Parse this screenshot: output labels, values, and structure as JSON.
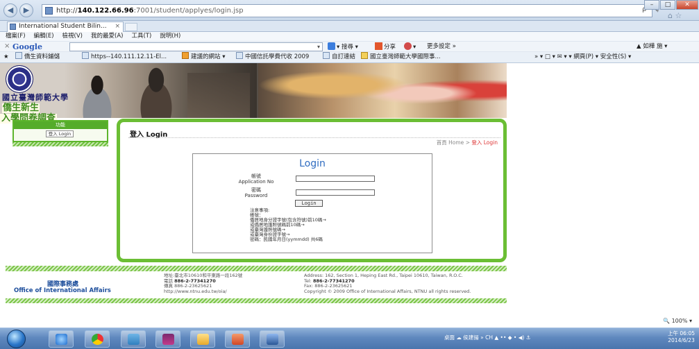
{
  "browser": {
    "address": {
      "prefix": "http://",
      "host": "140.122.66.96",
      "path": ":7001/student/applyes/login.jsp"
    },
    "address_icons": "ρ • ¢",
    "tab_title": "International Student Bilin...",
    "tab_close": "×",
    "menu": [
      "檔案(F)",
      "編輯(E)",
      "檢視(V)",
      "我的最愛(A)",
      "工具(T)",
      "說明(H)"
    ],
    "google": {
      "logo": "Google",
      "input_hint": "▾",
      "search_btn": "▾ 搜尋 ▾",
      "share_btn": "分享",
      "more_btn": "▾",
      "settings": "更多設定 »",
      "user": "如樺 施 ▾"
    },
    "favorites": [
      "僑生資料鋪儲",
      "https--140.111.12.11-El...",
      "建議的網站 ▾",
      "中國信託學費代收 2009",
      "自訂連結",
      "國立臺灣師範大學國際事..."
    ],
    "fav_tools": "»   ▾ □ ▾ ✉ ▾   ▾ 網頁(P) ▾  安全性(S) ▾"
  },
  "site": {
    "university_name": "國立臺灣師範大學",
    "survey_title_line1": "僑生新生",
    "survey_title_line2": "入學問卷調查",
    "nav": {
      "header": "功能",
      "login_link": "登入 Login"
    },
    "page_heading": "登入 Login",
    "breadcrumb": {
      "home": "首頁 Home",
      "sep": " > ",
      "current": "登入 Login"
    },
    "login": {
      "title": "Login",
      "account_label_zh": "帳號",
      "account_label_en": "Application No",
      "account_value": "",
      "password_label_zh": "密碼",
      "password_label_en": "Password",
      "password_value": "",
      "button": "Login",
      "notes": [
        "注意事項:",
        "帳號：",
        "僑居地身分證字號(包含符號)前10碼→",
        "或僑居地護照號碼前10碼→",
        "或臺灣護照號碼→",
        "或臺灣身份證字號→",
        "密碼：民國年月日(yymmdd) 共6碼"
      ]
    },
    "footer": {
      "office_cn": "國際事務處",
      "office_en": "Office of International Affairs",
      "addr_cn": "地址:臺北市10610和平東路一段162號",
      "tel_cn_label": "電話 ",
      "tel_cn": "886-2-77341270",
      "fax_cn": "傳真 886-2-23625621",
      "url": "http://www.ntnu.edu.tw/oia/",
      "addr_en": "Address: 162, Section 1, Heping East Rd., Taipei 10610, Taiwan, R.O.C.",
      "tel_en_label": "Tel: ",
      "tel_en": "886-2-77341270",
      "fax_en": "Fax: 886-2-23625621",
      "copyright": "Copyright © 2009 Office of International Affairs, NTNU all rights reserved."
    }
  },
  "status": {
    "zoom": "🔍 100%  ▾"
  },
  "taskbar": {
    "tray": "桌面  ☁  侯建揚  »   CH  ▲  ••  ◆  •  ◀)  ⚓",
    "time": "上午 06:05",
    "date": "2014/6/23"
  }
}
